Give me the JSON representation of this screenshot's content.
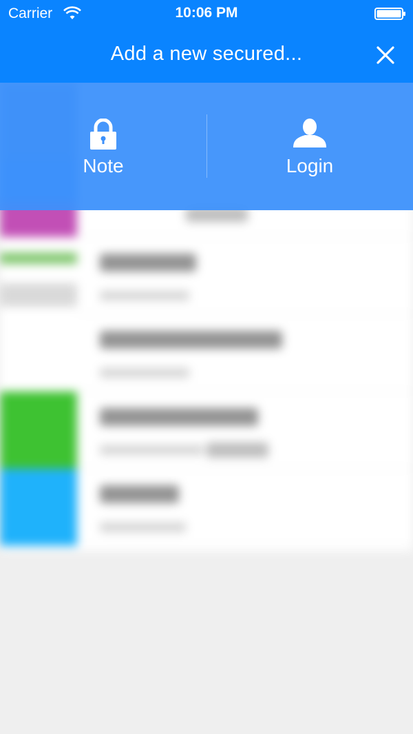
{
  "status_bar": {
    "carrier": "Carrier",
    "time": "10:06 PM",
    "icons": [
      "wifi-icon",
      "battery-icon"
    ]
  },
  "nav": {
    "title_em": "Add",
    "title_rest": " a new secured...",
    "close_icon": "close-icon"
  },
  "add_options": [
    {
      "label": "Note",
      "icon": "lock-icon"
    },
    {
      "label": "Login",
      "icon": "person-icon"
    }
  ],
  "colors": {
    "nav_blue": "#0a84ff",
    "panel_blue": "#3d91fb",
    "background": "#efefef",
    "list_bg": "#ffffff",
    "thumb_magenta": "#c24fb6",
    "thumb_green": "#3ec232",
    "thumb_cyan": "#1fb2fb",
    "thumb_blue": "#3c86f5"
  }
}
